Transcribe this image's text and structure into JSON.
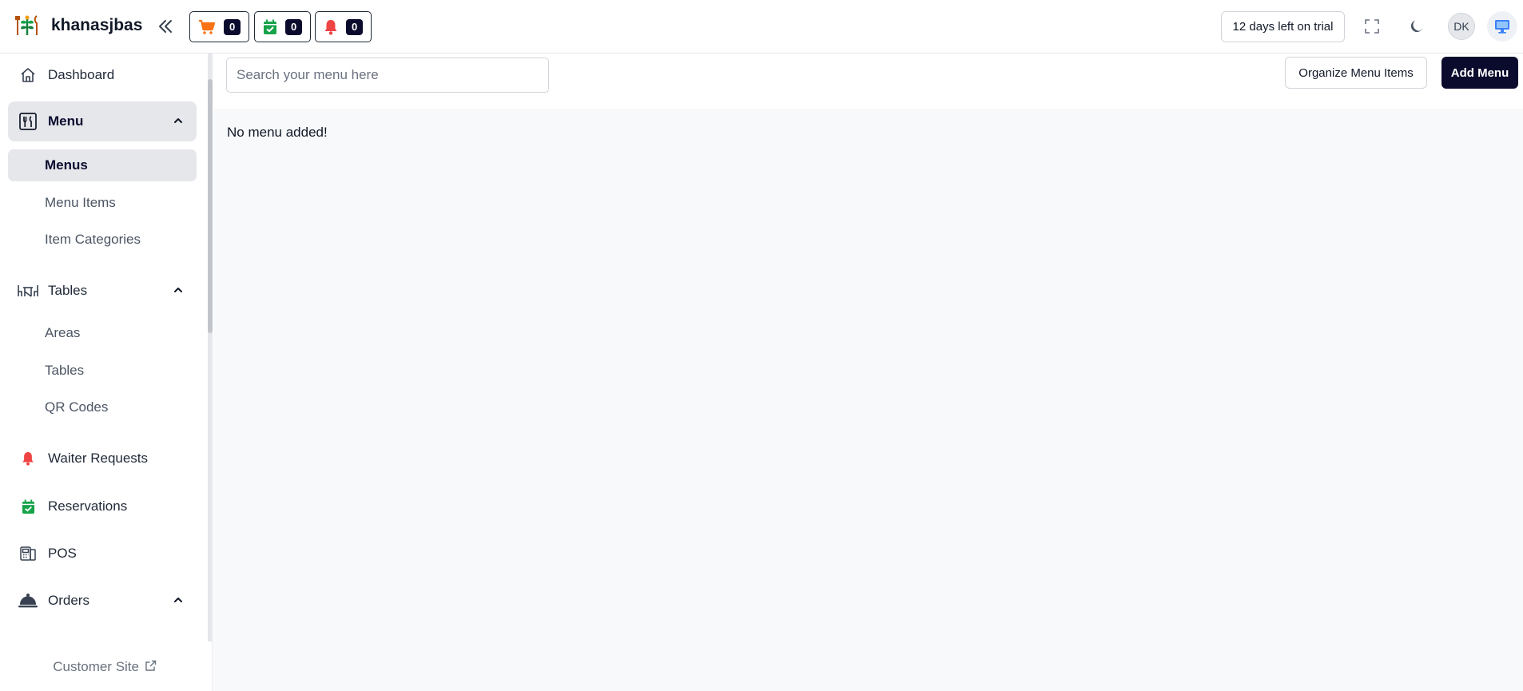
{
  "brand": {
    "name": "khanasjbas"
  },
  "counters": [
    {
      "icon": "cart-icon",
      "count": "0",
      "color": "#f97316"
    },
    {
      "icon": "calendar-check-icon",
      "count": "0",
      "color": "#16a34a"
    },
    {
      "icon": "bell-icon",
      "count": "0",
      "color": "#ef4444"
    }
  ],
  "header": {
    "trial_text": "12 days left on trial",
    "avatar_initials": "DK"
  },
  "sidebar": {
    "dashboard": "Dashboard",
    "menu": {
      "label": "Menu",
      "items": [
        "Menus",
        "Menu Items",
        "Item Categories"
      ]
    },
    "tables": {
      "label": "Tables",
      "items": [
        "Areas",
        "Tables",
        "QR Codes"
      ]
    },
    "waiter_requests": "Waiter Requests",
    "reservations": "Reservations",
    "pos": "POS",
    "orders": "Orders",
    "customer_site": "Customer Site"
  },
  "main": {
    "search_placeholder": "Search your menu here",
    "organize_button": "Organize Menu Items",
    "add_button": "Add Menu",
    "empty_message": "No menu added!"
  },
  "colors": {
    "accent_dark": "#0b0b2e",
    "active_bg": "#e5e7eb",
    "monitor_blue": "#3b82f6"
  }
}
